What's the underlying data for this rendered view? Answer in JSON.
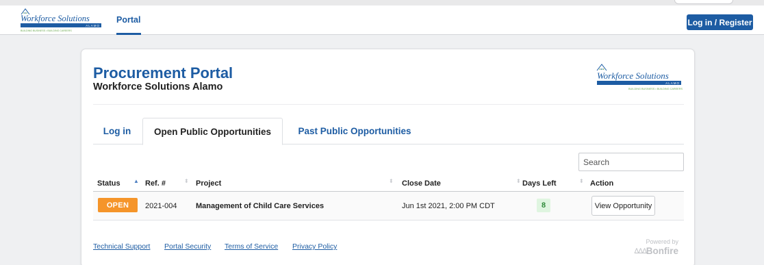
{
  "navbar": {
    "logo": {
      "name": "Workforce Solutions",
      "sub": "ALAMO",
      "tagline": "BUILDING BUSINESS • BUILDING CAREERS"
    },
    "portal_label": "Portal",
    "login_label": "Log in / Register"
  },
  "header": {
    "title": "Procurement Portal",
    "subtitle": "Workforce Solutions Alamo"
  },
  "tabs": [
    {
      "label": "Log in",
      "active": false
    },
    {
      "label": "Open Public Opportunities",
      "active": true
    },
    {
      "label": "Past Public Opportunities",
      "active": false
    }
  ],
  "search": {
    "placeholder": "Search"
  },
  "table": {
    "columns": [
      "Status",
      "Ref. #",
      "Project",
      "Close Date",
      "Days Left",
      "Action"
    ],
    "rows": [
      {
        "status": "OPEN",
        "ref": "2021-004",
        "project": "Management of Child Care Services",
        "close_date": "Jun 1st 2021, 2:00 PM CDT",
        "days_left": "8",
        "action": "View Opportunity"
      }
    ]
  },
  "footer": {
    "links": [
      "Technical Support",
      "Portal Security",
      "Terms of Service",
      "Privacy Policy"
    ],
    "powered_by": "Powered by",
    "brand": "Bonfire"
  },
  "colors": {
    "brand_blue": "#1d5ca3",
    "open_badge": "#f5952a",
    "days_badge_bg": "#dff5e0",
    "days_badge_text": "#2f8a3a",
    "logo_green": "#6aa84f"
  },
  "icons": [
    "logo-house-icon",
    "sort-asc-icon",
    "sort-icon",
    "bonfire-flames-icon"
  ]
}
